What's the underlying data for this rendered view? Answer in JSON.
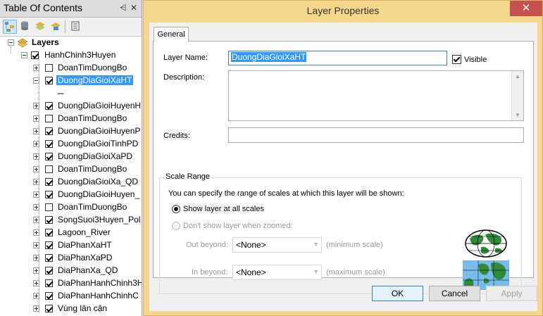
{
  "toc": {
    "title": "Table Of Contents",
    "pin_glyph": "⩤",
    "close_glyph": "✕",
    "toolbar_icons": [
      "list-by-drawing-order-icon",
      "list-by-source-icon",
      "list-by-visibility-icon",
      "list-by-selection-icon",
      "options-icon"
    ],
    "root_label": "Layers",
    "group_label": "HanhChinh3Huyen",
    "selected_legend": "---",
    "layers": [
      {
        "label": "DoanTimDuongBo",
        "checked": false
      },
      {
        "label": "DuongDiaGioiXaHT",
        "checked": true,
        "selected": true
      },
      {
        "label": "DuongDiaGioiHuyenH",
        "checked": true
      },
      {
        "label": "DoanTimDuongBo",
        "checked": false
      },
      {
        "label": "DuongDiaGioiHuyenP",
        "checked": true
      },
      {
        "label": "DuongDiaGioiTinhPD",
        "checked": true
      },
      {
        "label": "DuongDiaGioiXaPD",
        "checked": true
      },
      {
        "label": "DoanTimDuongBo",
        "checked": false
      },
      {
        "label": "DuongDiaGioiXa_QD",
        "checked": true
      },
      {
        "label": "DuongDiaGioiHuyen_",
        "checked": true
      },
      {
        "label": "DoanTimDuongBo",
        "checked": false
      },
      {
        "label": "SongSuoi3Huyen_Pol",
        "checked": true
      },
      {
        "label": "Lagoon_River",
        "checked": true
      },
      {
        "label": "DiaPhanXaHT",
        "checked": true
      },
      {
        "label": "DiaPhanXaPD",
        "checked": true
      },
      {
        "label": "DiaPhanXa_QD",
        "checked": true
      },
      {
        "label": "DiaPhanHanhChinh3H",
        "checked": true
      },
      {
        "label": "DiaPhanHanhChinhC",
        "checked": true
      },
      {
        "label": "Vùng lân cận",
        "checked": true
      }
    ]
  },
  "dialog": {
    "title": "Layer Properties",
    "close_glyph": "✕",
    "tab_general": "General",
    "layer_name_label": "Layer Name:",
    "layer_name_value": "DuongDiaGioiXaHT",
    "visible_label": "Visible",
    "visible_checked": true,
    "description_label": "Description:",
    "description_value": "",
    "credits_label": "Credits:",
    "credits_value": "",
    "scale_range": {
      "title": "Scale Range",
      "info": "You can specify the range of scales at which this layer will be shown:",
      "show_all_label": "Show layer at all scales",
      "dont_show_label": "Don't show layer when zoomed:",
      "out_beyond_label": "Out beyond:",
      "out_beyond_value": "<None>",
      "out_beyond_hint": "(minimum scale)",
      "in_beyond_label": "In beyond:",
      "in_beyond_value": "<None>",
      "in_beyond_hint": "(maximum scale)",
      "selected": "show_all"
    },
    "buttons": {
      "ok": "OK",
      "cancel": "Cancel",
      "apply": "Apply"
    },
    "colors": {
      "title_bar": "#f5d78b",
      "close_button": "#c75050",
      "selection": "#3399ff"
    }
  }
}
